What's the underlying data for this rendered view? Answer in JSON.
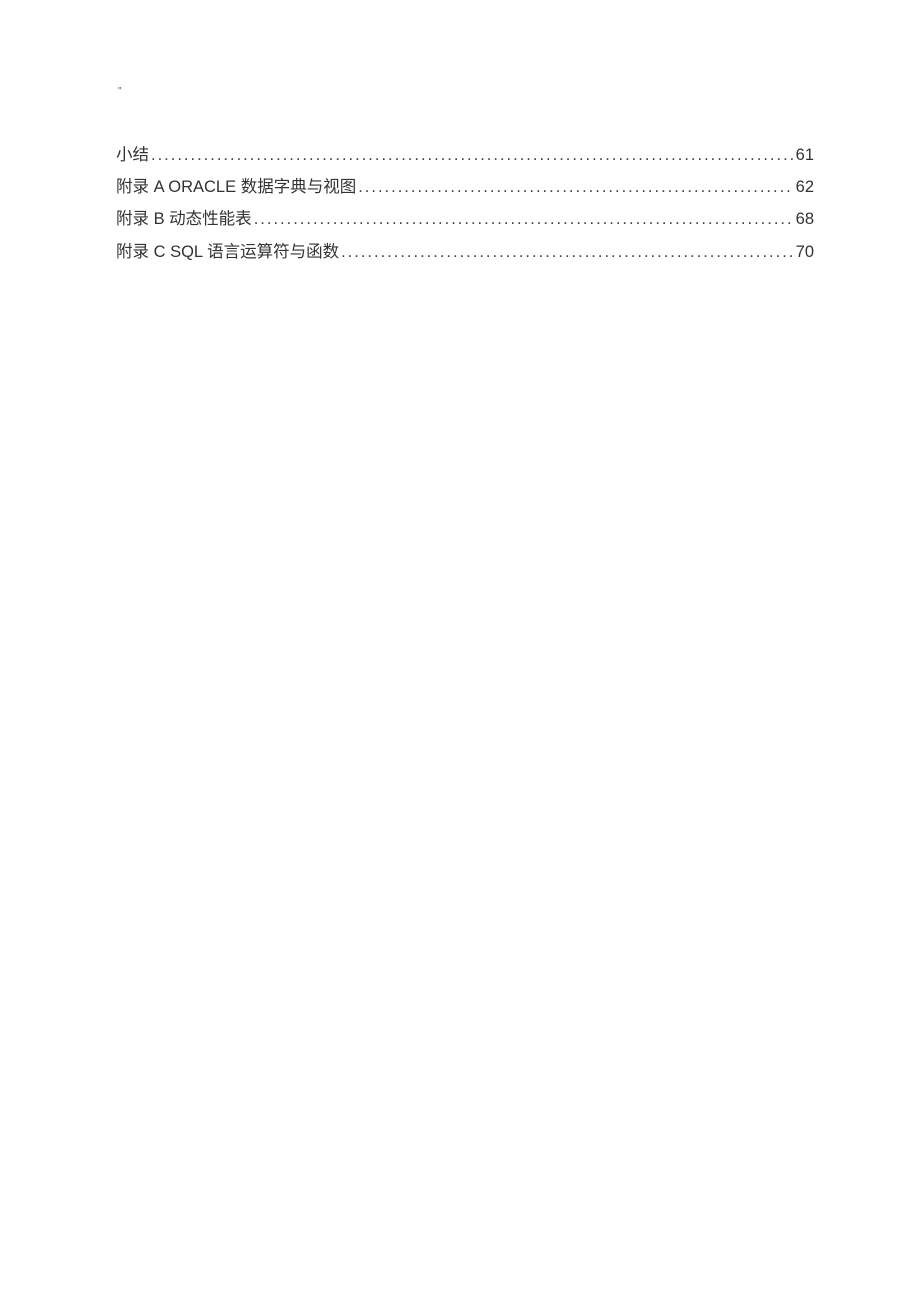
{
  "header_mark": "\"",
  "toc": {
    "entries": [
      {
        "title": "小结",
        "page": "61"
      },
      {
        "title": "附录 A   ORACLE 数据字典与视图",
        "page": "62"
      },
      {
        "title": "附录 B   动态性能表",
        "page": "68"
      },
      {
        "title": "附录 C     SQL 语言运算符与函数",
        "page": "70"
      }
    ]
  }
}
